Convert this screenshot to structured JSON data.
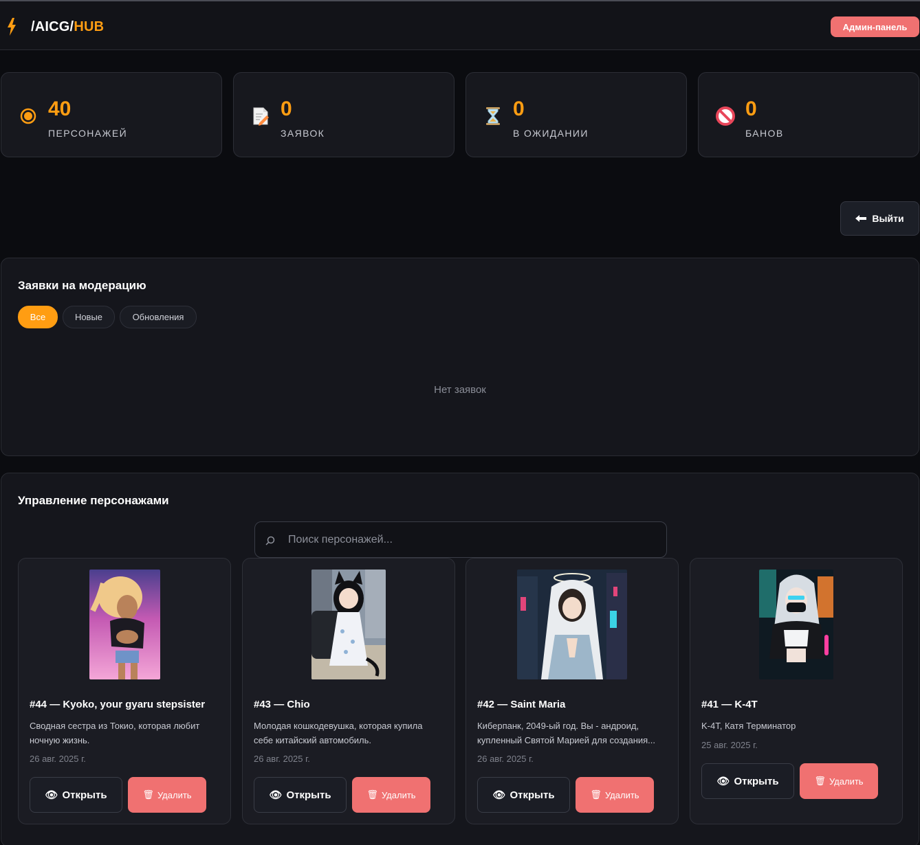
{
  "header": {
    "logo_prefix": "/AICG/",
    "logo_accent": "HUB",
    "admin_button": "Админ-панель"
  },
  "stats": [
    {
      "icon": "target-icon",
      "value": "40",
      "label": "ПЕРСОНАЖЕЙ"
    },
    {
      "icon": "memo-icon",
      "value": "0",
      "label": "ЗАЯВОК"
    },
    {
      "icon": "hourglass-icon",
      "value": "0",
      "label": "В ОЖИДАНИИ"
    },
    {
      "icon": "ban-icon",
      "value": "0",
      "label": "БАНОВ"
    }
  ],
  "logout_button": "Выйти",
  "moderation": {
    "title": "Заявки на модерацию",
    "filters": [
      "Все",
      "Новые",
      "Обновления"
    ],
    "active_filter": "Все",
    "empty_text": "Нет заявок"
  },
  "management": {
    "title": "Управление персонажами",
    "search_placeholder": "Поиск персонажей...",
    "open_label": "Открыть",
    "delete_label": "Удалить",
    "characters": [
      {
        "title": "#44 — Kyoko, your gyaru stepsister",
        "desc_line1": "Сводная сестра из Токио, которая любит",
        "desc_line2": "ночную жизнь.",
        "date": "26 авг. 2025 г."
      },
      {
        "title": "#43 — Chio",
        "desc_line1": "Молодая кошкодевушка, которая купила",
        "desc_line2": "себе китайский автомобиль.",
        "date": "26 авг. 2025 г."
      },
      {
        "title": "#42 — Saint Maria",
        "desc_line1": "Киберпанк, 2049-ый год. Вы - андроид,",
        "desc_line2": "купленный Святой Марией для создания...",
        "date": "26 авг. 2025 г."
      },
      {
        "title": "#41 — K-4T",
        "desc_line1": "K-4T, Катя Терминатор",
        "desc_line2": "",
        "date": "25 авг. 2025 г."
      }
    ]
  },
  "colors": {
    "accent": "#ff9d12",
    "danger": "#f07171",
    "background": "#0b0c10",
    "panel": "#15161c"
  }
}
